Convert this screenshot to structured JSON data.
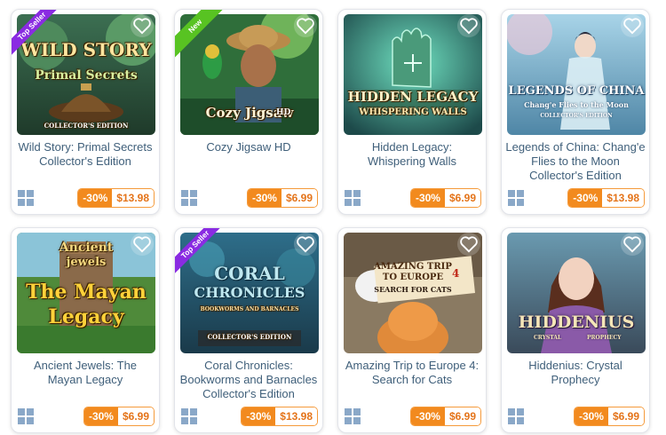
{
  "platform_icon": "windows-icon",
  "heart_icon": "heart-outline-icon",
  "colors": {
    "accent_orange": "#f28a1e",
    "title_text": "#3f5f7a",
    "badge_top_seller": "#8a2be2",
    "badge_new": "#58c322"
  },
  "games": [
    {
      "title": "Wild Story: Primal Secrets Collector's Edition",
      "badge": "Top Seller",
      "art_text": [
        "WILD STORY",
        "Primal Secrets",
        "COLLECTOR'S EDITION"
      ],
      "discount": "-30%",
      "price": "$13.98"
    },
    {
      "title": "Cozy Jigsaw HD",
      "badge": "New",
      "art_text": [
        "Cozy Jigsaw",
        "HD"
      ],
      "discount": "-30%",
      "price": "$6.99"
    },
    {
      "title": "Hidden Legacy: Whispering Walls",
      "badge": "",
      "art_text": [
        "HIDDEN LEGACY",
        "WHISPERING WALLS"
      ],
      "discount": "-30%",
      "price": "$6.99"
    },
    {
      "title": "Legends of China: Chang'e Flies to the Moon Collector's Edition",
      "badge": "",
      "art_text": [
        "LEGENDS OF CHINA",
        "Chang'e Flies to the Moon",
        "COLLECTOR'S EDITION"
      ],
      "discount": "-30%",
      "price": "$13.98"
    },
    {
      "title": "Ancient Jewels: The Mayan Legacy",
      "badge": "",
      "art_text": [
        "Ancient",
        "jewels",
        "The Mayan",
        "Legacy"
      ],
      "discount": "-30%",
      "price": "$6.99"
    },
    {
      "title": "Coral Chronicles: Bookworms and Barnacles Collector's Edition",
      "badge": "Top Seller",
      "art_text": [
        "CORAL",
        "CHRONICLES",
        "BOOKWORMS AND BARNACLES",
        "COLLECTOR'S EDITION"
      ],
      "discount": "-30%",
      "price": "$13.98"
    },
    {
      "title": "Amazing Trip to Europe 4: Search for Cats",
      "badge": "",
      "art_text": [
        "AMAZING TRIP",
        "TO EUROPE",
        "4",
        "SEARCH FOR CATS"
      ],
      "discount": "-30%",
      "price": "$6.99"
    },
    {
      "title": "Hiddenius: Crystal Prophecy",
      "badge": "",
      "art_text": [
        "HIDDENIUS",
        "CRYSTAL",
        "PROPHECY"
      ],
      "discount": "-30%",
      "price": "$6.99"
    }
  ]
}
